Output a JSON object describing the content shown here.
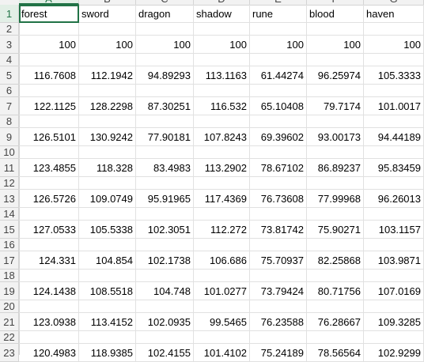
{
  "columns": [
    "A",
    "B",
    "C",
    "D",
    "E",
    "F",
    "G"
  ],
  "rows": [
    {
      "num": "1",
      "values": [
        "forest",
        "sword",
        "dragon",
        "shadow",
        "rune",
        "blood",
        "haven"
      ],
      "kind": "text"
    },
    {
      "num": "2",
      "values": [
        "",
        "",
        "",
        "",
        "",
        "",
        ""
      ],
      "kind": "num"
    },
    {
      "num": "3",
      "values": [
        "100",
        "100",
        "100",
        "100",
        "100",
        "100",
        "100"
      ],
      "kind": "num"
    },
    {
      "num": "4",
      "values": [
        "",
        "",
        "",
        "",
        "",
        "",
        ""
      ],
      "kind": "num"
    },
    {
      "num": "5",
      "values": [
        "116.7608",
        "112.1942",
        "94.89293",
        "113.1163",
        "61.44274",
        "96.25974",
        "105.3333"
      ],
      "kind": "num"
    },
    {
      "num": "6",
      "values": [
        "",
        "",
        "",
        "",
        "",
        "",
        ""
      ],
      "kind": "num"
    },
    {
      "num": "7",
      "values": [
        "122.1125",
        "128.2298",
        "87.30251",
        "116.532",
        "65.10408",
        "79.7174",
        "101.0017"
      ],
      "kind": "num"
    },
    {
      "num": "8",
      "values": [
        "",
        "",
        "",
        "",
        "",
        "",
        ""
      ],
      "kind": "num"
    },
    {
      "num": "9",
      "values": [
        "126.5101",
        "130.9242",
        "77.90181",
        "107.8243",
        "69.39602",
        "93.00173",
        "94.44189"
      ],
      "kind": "num"
    },
    {
      "num": "10",
      "values": [
        "",
        "",
        "",
        "",
        "",
        "",
        ""
      ],
      "kind": "num"
    },
    {
      "num": "11",
      "values": [
        "123.4855",
        "118.328",
        "83.4983",
        "113.2902",
        "78.67102",
        "86.89237",
        "95.83459"
      ],
      "kind": "num"
    },
    {
      "num": "12",
      "values": [
        "",
        "",
        "",
        "",
        "",
        "",
        ""
      ],
      "kind": "num"
    },
    {
      "num": "13",
      "values": [
        "126.5726",
        "109.0749",
        "95.91965",
        "117.4369",
        "76.73608",
        "77.99968",
        "96.26013"
      ],
      "kind": "num"
    },
    {
      "num": "14",
      "values": [
        "",
        "",
        "",
        "",
        "",
        "",
        ""
      ],
      "kind": "num"
    },
    {
      "num": "15",
      "values": [
        "127.0533",
        "105.5338",
        "102.3051",
        "112.272",
        "73.81742",
        "75.90271",
        "103.1157"
      ],
      "kind": "num"
    },
    {
      "num": "16",
      "values": [
        "",
        "",
        "",
        "",
        "",
        "",
        ""
      ],
      "kind": "num"
    },
    {
      "num": "17",
      "values": [
        "124.331",
        "104.854",
        "102.1738",
        "106.686",
        "75.70937",
        "82.25868",
        "103.9871"
      ],
      "kind": "num"
    },
    {
      "num": "18",
      "values": [
        "",
        "",
        "",
        "",
        "",
        "",
        ""
      ],
      "kind": "num"
    },
    {
      "num": "19",
      "values": [
        "124.1438",
        "108.5518",
        "104.748",
        "101.0277",
        "73.79424",
        "80.71756",
        "107.0169"
      ],
      "kind": "num"
    },
    {
      "num": "20",
      "values": [
        "",
        "",
        "",
        "",
        "",
        "",
        ""
      ],
      "kind": "num"
    },
    {
      "num": "21",
      "values": [
        "123.0938",
        "113.4152",
        "102.0935",
        "99.5465",
        "76.23588",
        "76.28667",
        "109.3285"
      ],
      "kind": "num"
    },
    {
      "num": "22",
      "values": [
        "",
        "",
        "",
        "",
        "",
        "",
        ""
      ],
      "kind": "num"
    },
    {
      "num": "23",
      "values": [
        "120.4983",
        "118.9385",
        "102.4155",
        "101.4102",
        "75.24189",
        "78.56564",
        "102.9299"
      ],
      "kind": "num"
    }
  ],
  "selected_cell": "A1",
  "colors": {
    "accent": "#217346",
    "header_bg": "#f2f2f2",
    "grid": "#e1e1e1"
  }
}
